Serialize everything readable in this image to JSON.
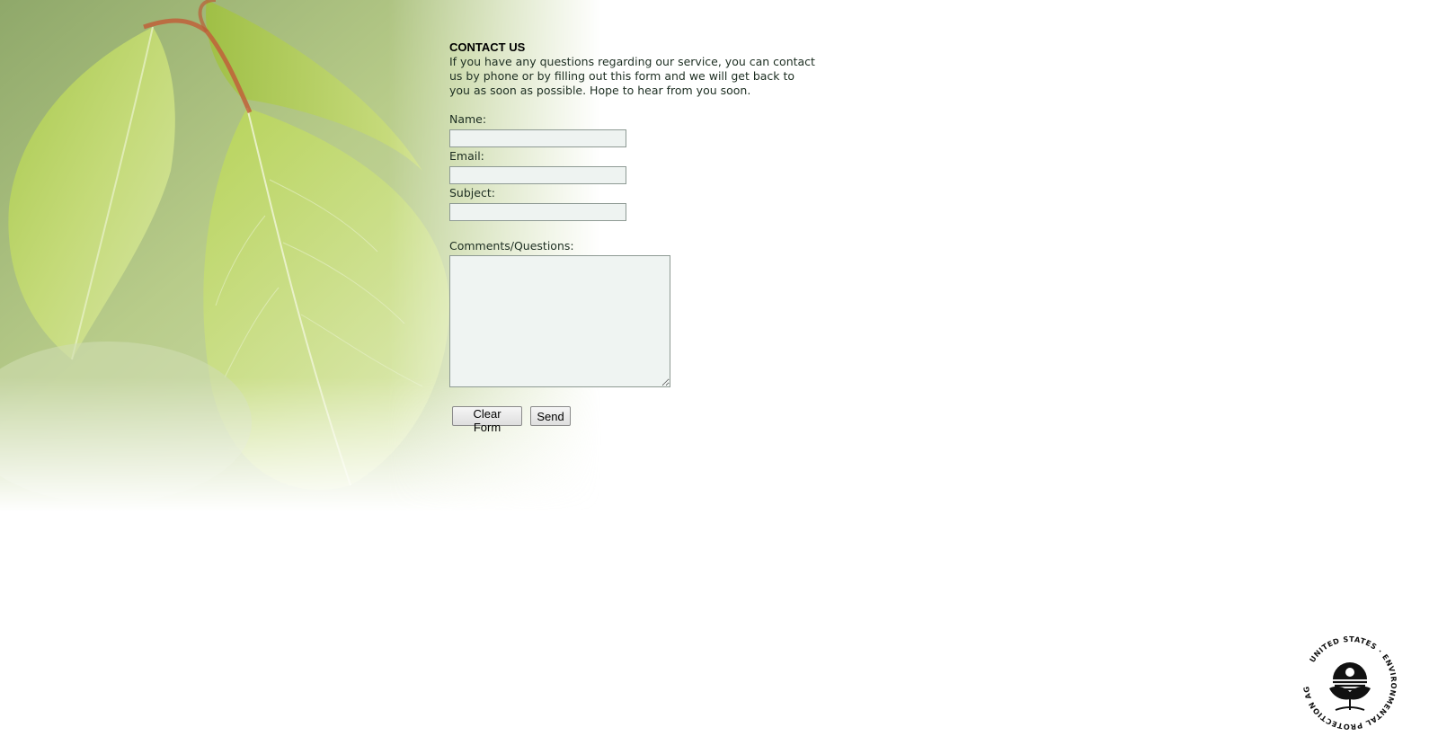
{
  "contact": {
    "title": "CONTACT US",
    "intro": "If you have any questions regarding our service, you can contact us by phone or by filling out this form and we will get back to you as soon as possible. Hope to hear from you soon."
  },
  "form": {
    "name_label": "Name:",
    "name_value": "",
    "email_label": "Email:",
    "email_value": "",
    "subject_label": "Subject:",
    "subject_value": "",
    "comments_label": "Comments/Questions:",
    "comments_value": "",
    "clear_label": "Clear Form",
    "send_label": "Send"
  },
  "seal": {
    "text": "UNITED STATES ENVIRONMENTAL PROTECTION AGENCY",
    "icon": "epa-seal-icon"
  },
  "colors": {
    "text": "#1d2e22",
    "input_bg": "#eef3f1",
    "input_border": "#8e9a94",
    "leaf_green": "#b5d16a"
  }
}
